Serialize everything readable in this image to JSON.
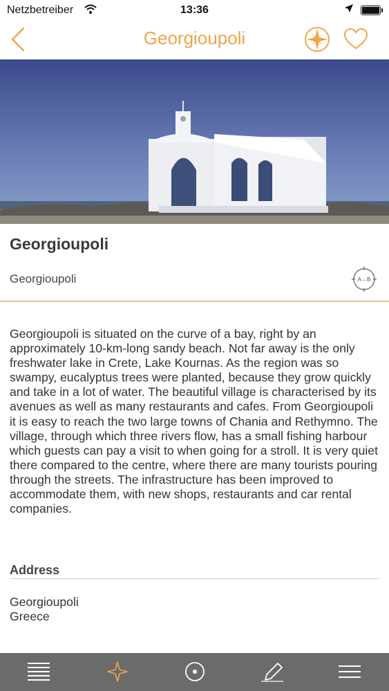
{
  "status_bar": {
    "carrier": "Netzbetreiber",
    "time": "13:36"
  },
  "nav": {
    "title": "Georgioupoli",
    "accent_color": "#f0a54a"
  },
  "place": {
    "title": "Georgioupoli",
    "subtitle": "Georgioupoli",
    "route_button_label": "A→B"
  },
  "description": "Georgioupoli is situated on the curve of a bay, right by an approximately 10-km-long sandy beach. Not far away is the only freshwater lake in Crete, Lake Kournas. As the region was so swampy, eucalyptus trees were planted, because they grow quickly and take in a lot of water. The beautiful village is characterised by its avenues as well as many restaurants and cafes. From Georgioupoli it is easy to reach the two large towns of Chania and Rethymno. The village, through which three rivers flow, has a small fishing harbour which guests can pay a visit to when going for a stroll. It is very quiet there compared to the centre, where there are many tourists pouring through the streets. The infrastructure has been improved to accommodate them, with new shops, restaurants and car rental companies.",
  "address": {
    "heading": "Address",
    "line1": "Georgioupoli",
    "line2": "Greece"
  },
  "tab_bar": {
    "tabs": [
      {
        "icon": "list-icon"
      },
      {
        "icon": "star-icon",
        "active": true
      },
      {
        "icon": "location-icon"
      },
      {
        "icon": "pencil-icon"
      },
      {
        "icon": "menu-icon"
      }
    ]
  }
}
